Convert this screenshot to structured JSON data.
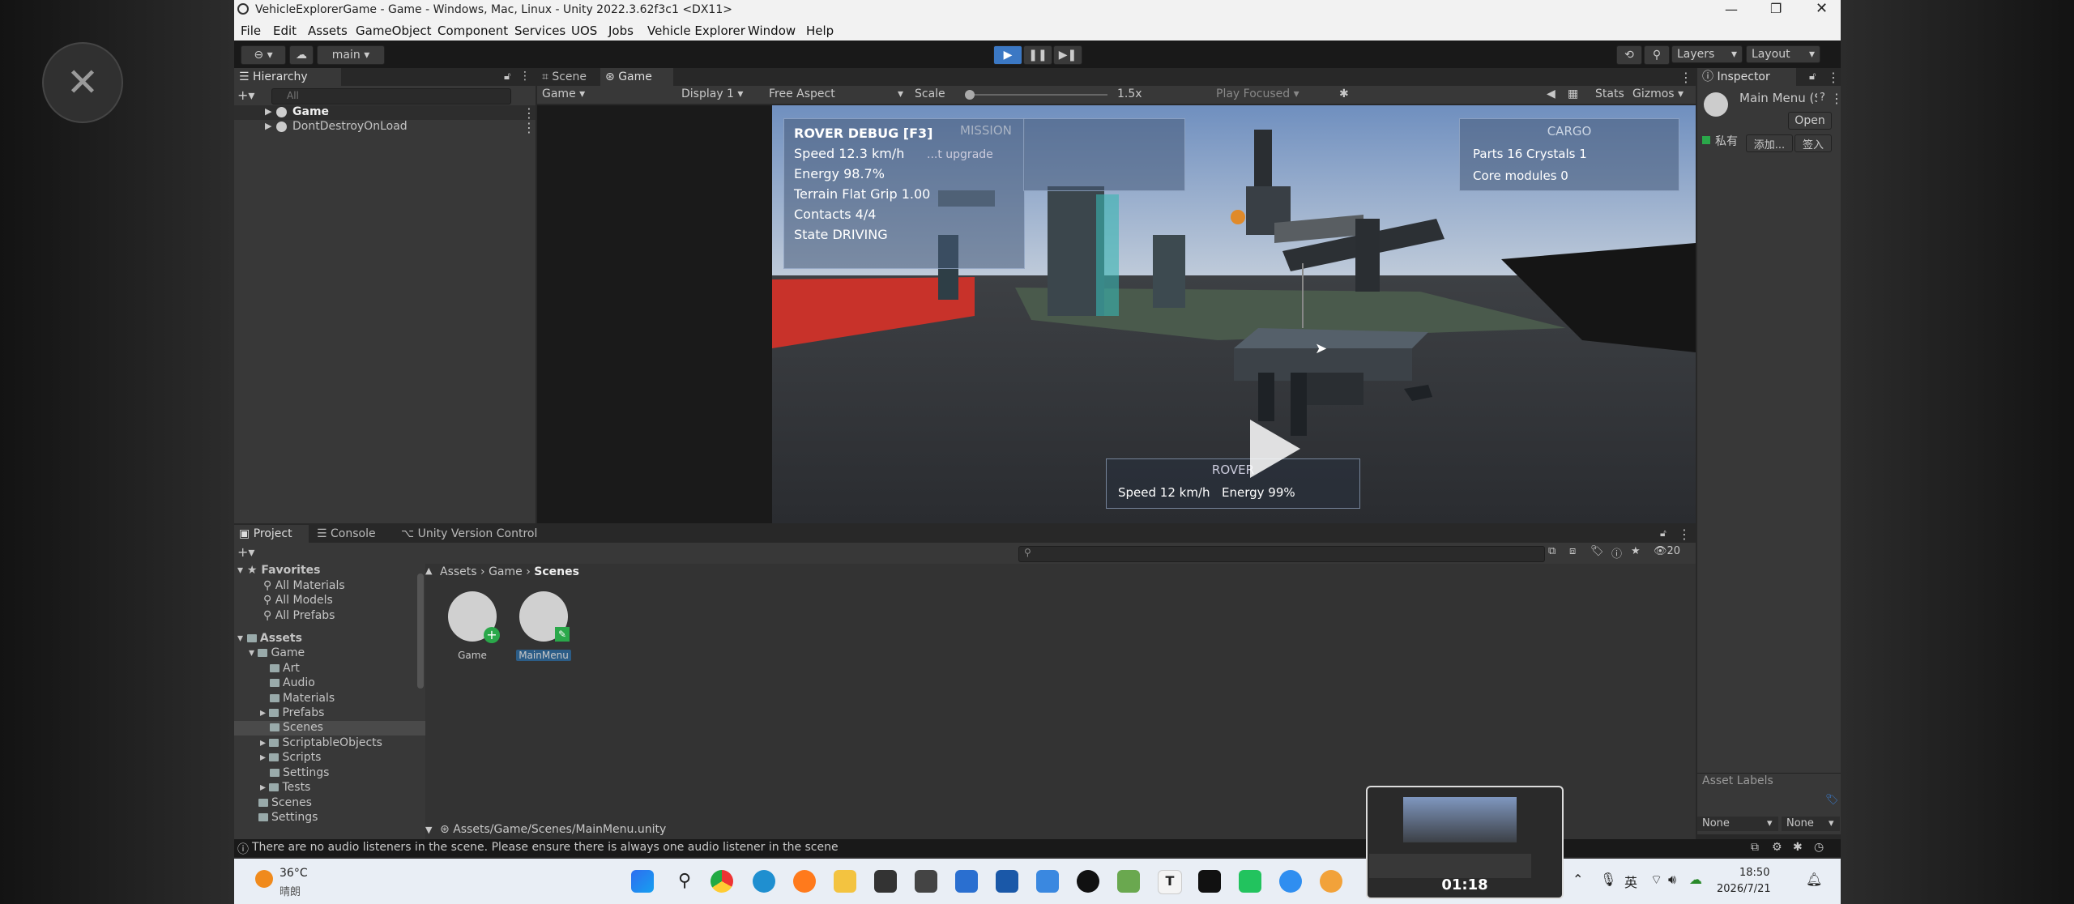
{
  "window": {
    "title": "VehicleExplorerGame - Game - Windows, Mac, Linux - Unity 2022.3.62f3c1 <DX11>"
  },
  "menu": [
    "File",
    "Edit",
    "Assets",
    "GameObject",
    "Component",
    "Services",
    "UOS",
    "Jobs",
    "Vehicle Explorer",
    "Window",
    "Help"
  ],
  "toolbar": {
    "branch": "main",
    "layers": "Layers",
    "layout": "Layout"
  },
  "hierarchy": {
    "tab": "Hierarchy",
    "search_placeholder": "All",
    "items": [
      "Game",
      "DontDestroyOnLoad"
    ]
  },
  "scene_tabs": {
    "scene": "Scene",
    "game": "Game"
  },
  "game_toolbar": {
    "view": "Game",
    "display": "Display 1",
    "aspect": "Free Aspect",
    "scale_label": "Scale",
    "scale_value": "1.5x",
    "play_mode": "Play Focused",
    "stats": "Stats",
    "gizmos": "Gizmos"
  },
  "hud": {
    "mission_title": "MISSION",
    "mission_text": "...t upgrade",
    "rover_debug": {
      "title": "ROVER DEBUG  [F3]",
      "lines": [
        "Speed    12.3 km/h",
        "Energy    98.7%",
        "Terrain   Flat  Grip 1.00",
        "Contacts  4/4",
        "State     DRIVING"
      ]
    },
    "cargo": {
      "title": "CARGO",
      "line1": "Parts 16    Crystals 1",
      "line2": "Core modules 0"
    },
    "rover_panel": {
      "title": "ROVER",
      "speed": "Speed 12 km/h",
      "energy": "Energy 99%"
    }
  },
  "inspector": {
    "tab": "Inspector",
    "asset_title": "Main Menu (Scene Asset)",
    "open_button": "Open",
    "private_label": "私有",
    "add_button": "添加...",
    "sign_button": "签入",
    "asset_labels": "Asset Labels",
    "none1": "None",
    "none2": "None"
  },
  "project": {
    "tabs": [
      "Project",
      "Console",
      "Unity Version Control"
    ],
    "count": "20",
    "favorites": {
      "label": "Favorites",
      "items": [
        "All Materials",
        "All Models",
        "All Prefabs"
      ]
    },
    "assets_label": "Assets",
    "tree": [
      "Game",
      "Art",
      "Audio",
      "Materials",
      "Prefabs",
      "Scenes",
      "ScriptableObjects",
      "Scripts",
      "Settings",
      "Tests",
      "Scenes",
      "Settings"
    ],
    "breadcrumb": [
      "Assets",
      "Game",
      "Scenes"
    ],
    "files": [
      "Game",
      "MainMenu"
    ],
    "path": "Assets/Game/Scenes/MainMenu.unity"
  },
  "status": {
    "message": "There are no audio listeners in the scene. Please ensure there is always one audio listener in the scene"
  },
  "video": {
    "timer": "01:18"
  },
  "taskbar": {
    "temp": "36°C",
    "weather": "晴朗",
    "ime": "英",
    "time": "18:50",
    "date": "2026/7/21"
  },
  "colors": {
    "accent": "#3b78c4",
    "window_bg": "#282828",
    "panel_bg": "#383838",
    "taskbar_bg": "#e9eef5"
  }
}
